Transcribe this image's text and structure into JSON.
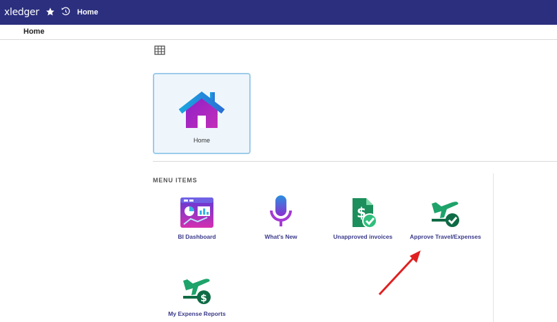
{
  "topbar": {
    "brand": "xledger",
    "breadcrumb": "Home",
    "icons": [
      "star-icon",
      "history-icon"
    ],
    "background": "#2b2f7e"
  },
  "subbar": {
    "title": "Home"
  },
  "home_card": {
    "label": "Home",
    "icon": "house-icon"
  },
  "menu": {
    "section_title": "MENU ITEMS",
    "items": [
      {
        "label": "BI Dashboard",
        "icon": "bi-dashboard-icon"
      },
      {
        "label": "What's New",
        "icon": "microphone-icon"
      },
      {
        "label": "Unapproved invoices",
        "icon": "invoice-check-icon"
      },
      {
        "label": "Approve Travel/Expenses",
        "icon": "plane-check-icon"
      },
      {
        "label": "My Expense Reports",
        "icon": "plane-dollar-icon"
      }
    ]
  },
  "colors": {
    "link": "#3b3a8a",
    "card_bg": "#eef6fc",
    "card_border": "#9ccbea",
    "arrow": "#e02020"
  }
}
